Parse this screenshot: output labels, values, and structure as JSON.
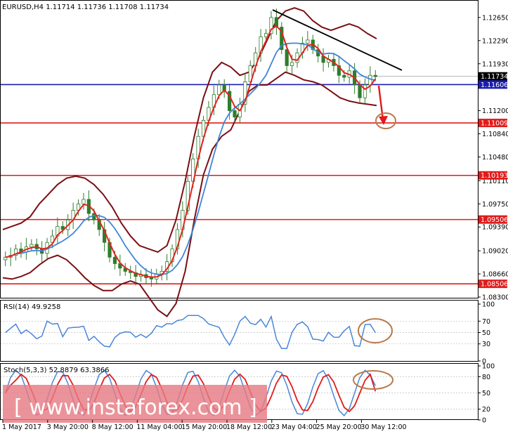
{
  "header": {
    "main": "EURUSD,H4  1.11714 1.11736 1.11708 1.11734",
    "rsi": "RSI(14) 49.9258",
    "stoch": "Stoch(5,3,3) 52.8879 63.3866"
  },
  "watermark": "[ www.instaforex.com ]",
  "colors": {
    "candle": "#2d7d2d",
    "bollinger": "#7a0f14",
    "ma_fast": "#e0241f",
    "ma_slow": "#3f86d8",
    "support": "#e01b1b",
    "current_price_line": "#1b1bb0",
    "arrow": "#e01b1b",
    "circle": "#b87a4b",
    "rsi_line": "#4a86d8",
    "stoch_main": "#4a86d8",
    "stoch_signal": "#e01b1b",
    "trendline": "#000000"
  },
  "chart_data": [
    {
      "type": "candlestick",
      "symbol": "EURUSD",
      "timeframe": "H4",
      "ohlc": {
        "open": 1.11714,
        "high": 1.11736,
        "low": 1.11708,
        "close": 1.11734
      },
      "ylim": [
        1.083,
        1.129
      ],
      "y_ticks": [
        "1.12650",
        "1.12290",
        "1.11930",
        "1.11200",
        "1.10840",
        "1.10480",
        "1.10110",
        "1.09750",
        "1.09390",
        "1.09020",
        "1.08660",
        "1.08300"
      ],
      "x_tick_labels": [
        "1 May 2017",
        "3 May 20:00",
        "8 May 12:00",
        "11 May 04:00",
        "15 May 20:00",
        "18 May 12:00",
        "23 May 04:00",
        "25 May 20:00",
        "30 May 12:00"
      ],
      "levels": [
        {
          "label": "1.11734",
          "value": 1.11734,
          "kind": "current"
        },
        {
          "label": "1.11606",
          "value": 1.11606,
          "kind": "blue_line"
        },
        {
          "label": "1.11009",
          "value": 1.11009,
          "kind": "support"
        },
        {
          "label": "1.10193",
          "value": 1.10193,
          "kind": "support"
        },
        {
          "label": "1.09506",
          "value": 1.09506,
          "kind": "support"
        },
        {
          "label": "1.08506",
          "value": 1.08506,
          "kind": "support"
        }
      ],
      "closes": [
        1.0892,
        1.0895,
        1.0905,
        1.09,
        1.0908,
        1.0912,
        1.0905,
        1.0898,
        1.0915,
        1.0925,
        1.094,
        1.0935,
        1.095,
        1.0965,
        1.0975,
        1.0982,
        1.096,
        1.095,
        1.0935,
        1.0915,
        1.0892,
        1.0882,
        1.0875,
        1.087,
        1.0868,
        1.0862,
        1.0865,
        1.086,
        1.0858,
        1.0866,
        1.087,
        1.0885,
        1.0905,
        1.0935,
        1.0965,
        1.101,
        1.1045,
        1.108,
        1.1105,
        1.1125,
        1.1145,
        1.116,
        1.115,
        1.112,
        1.111,
        1.113,
        1.1165,
        1.119,
        1.121,
        1.1235,
        1.124,
        1.1265,
        1.125,
        1.1215,
        1.119,
        1.1195,
        1.121,
        1.1225,
        1.123,
        1.1215,
        1.1205,
        1.1195,
        1.12,
        1.119,
        1.1175,
        1.1172,
        1.1182,
        1.116,
        1.114,
        1.116,
        1.1175,
        1.1173
      ],
      "bollinger_upper": [
        1.0935,
        1.094,
        1.0945,
        1.0955,
        1.0975,
        1.099,
        1.1005,
        1.1015,
        1.1018,
        1.1015,
        1.1005,
        1.099,
        1.097,
        1.0945,
        1.0925,
        1.091,
        1.0905,
        1.09,
        1.091,
        1.095,
        1.101,
        1.108,
        1.114,
        1.118,
        1.1195,
        1.1188,
        1.1175,
        1.118,
        1.12,
        1.123,
        1.126,
        1.1275,
        1.128,
        1.1275,
        1.126,
        1.125,
        1.1245,
        1.125,
        1.1255,
        1.125,
        1.124,
        1.1232
      ],
      "bollinger_lower": [
        1.086,
        1.0858,
        1.0862,
        1.0868,
        1.088,
        1.089,
        1.0895,
        1.0888,
        1.0875,
        1.086,
        1.0848,
        1.084,
        1.084,
        1.085,
        1.0855,
        1.085,
        1.083,
        1.081,
        1.08,
        1.082,
        1.087,
        1.095,
        1.102,
        1.106,
        1.108,
        1.109,
        1.112,
        1.115,
        1.116,
        1.116,
        1.117,
        1.118,
        1.1175,
        1.1168,
        1.1165,
        1.116,
        1.115,
        1.114,
        1.1135,
        1.1132,
        1.113,
        1.1128
      ]
    },
    {
      "type": "line",
      "name": "RSI(14)",
      "value": 49.9258,
      "ylim": [
        0,
        100
      ],
      "y_ticks": [
        100,
        70,
        50,
        30,
        0
      ]
    },
    {
      "type": "line",
      "name": "Stoch(5,3,3)",
      "values": [
        52.8879,
        63.3866
      ],
      "ylim": [
        0,
        100
      ],
      "y_ticks": [
        100,
        80,
        50,
        20,
        0
      ]
    }
  ]
}
